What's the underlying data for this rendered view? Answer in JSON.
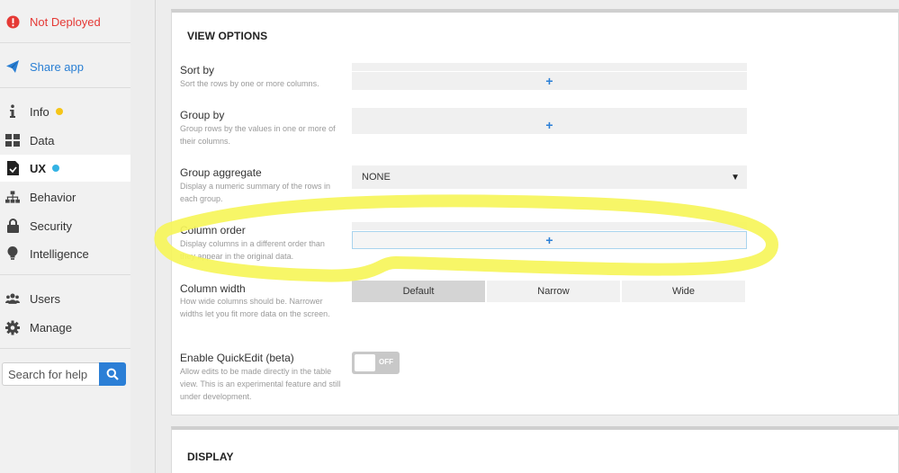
{
  "sidebar": {
    "deploy_status": "Not Deployed",
    "share": "Share app",
    "items": [
      {
        "label": "Info",
        "dot": "#f5c518"
      },
      {
        "label": "Data"
      },
      {
        "label": "UX",
        "dot": "#34b3e4"
      },
      {
        "label": "Behavior"
      },
      {
        "label": "Security"
      },
      {
        "label": "Intelligence"
      },
      {
        "label": "Users"
      },
      {
        "label": "Manage"
      }
    ],
    "search_placeholder": "Search for help"
  },
  "view_options": {
    "title": "VIEW OPTIONS",
    "sort_by": {
      "label": "Sort by",
      "desc": "Sort the rows by one or more columns.",
      "add": "+"
    },
    "group_by": {
      "label": "Group by",
      "desc": "Group rows by the values in one or more of their columns.",
      "add": "+"
    },
    "group_aggregate": {
      "label": "Group aggregate",
      "desc": "Display a numeric summary of the rows in each group.",
      "value": "NONE",
      "caret": "▼"
    },
    "column_order": {
      "label": "Column order",
      "desc": "Display columns in a different order than they appear in the original data.",
      "add": "+"
    },
    "column_width": {
      "label": "Column width",
      "desc": "How wide columns should be. Narrower widths let you fit more data on the screen.",
      "options": [
        "Default",
        "Narrow",
        "Wide"
      ],
      "selected": "Default"
    },
    "quickedit": {
      "label": "Enable QuickEdit (beta)",
      "desc": "Allow edits to be made directly in the table view. This is an experimental feature and still under development.",
      "state": "OFF"
    }
  },
  "display": {
    "title": "DISPLAY"
  },
  "colors": {
    "accent": "#2b7fd6",
    "alert": "#e53935",
    "highlight": "#f6f55a"
  }
}
